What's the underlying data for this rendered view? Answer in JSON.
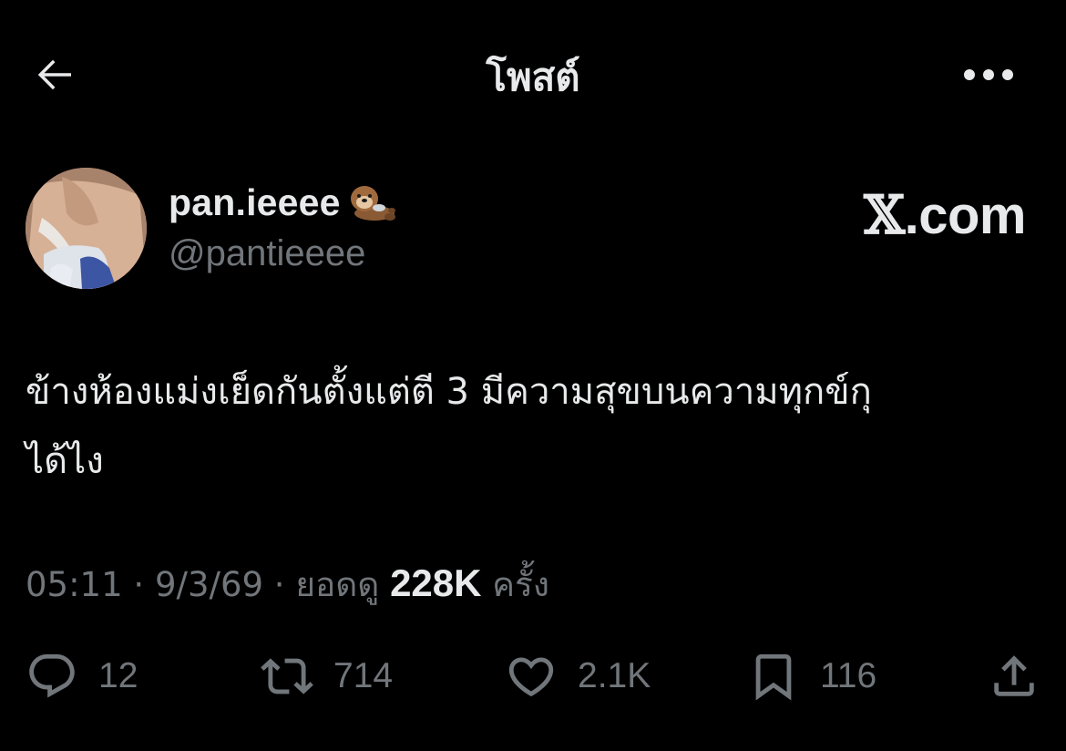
{
  "header": {
    "title": "โพสต์",
    "back_icon": "arrow-left-icon",
    "more_icon": "more-horizontal-icon"
  },
  "author": {
    "display_name": "pan.ieeee",
    "handle": "@pantieeee",
    "badge_icon": "otter-emoji-icon",
    "brand_prefix": "𝕏",
    "brand_suffix": ".com"
  },
  "tweet": {
    "text": "ข้างห้องแม่งเย็ดกันตั้งแต่ตี 3 มีความสุขบนความทุกข์กุ\nได้ไง"
  },
  "meta": {
    "time": "05:11",
    "sep1": " · ",
    "date": "9/3/69",
    "sep2": " · ",
    "views_label": "ยอดดู",
    "views_count": "228K",
    "views_unit": "ครั้ง"
  },
  "actions": {
    "reply": {
      "icon": "reply-icon",
      "count": "12"
    },
    "repost": {
      "icon": "repost-icon",
      "count": "714"
    },
    "like": {
      "icon": "heart-icon",
      "count": "2.1K"
    },
    "bookmark": {
      "icon": "bookmark-icon",
      "count": "116"
    },
    "share": {
      "icon": "share-icon"
    }
  },
  "colors": {
    "background": "#000000",
    "primary_text": "#e7e9ea",
    "secondary_text": "#71767b"
  }
}
